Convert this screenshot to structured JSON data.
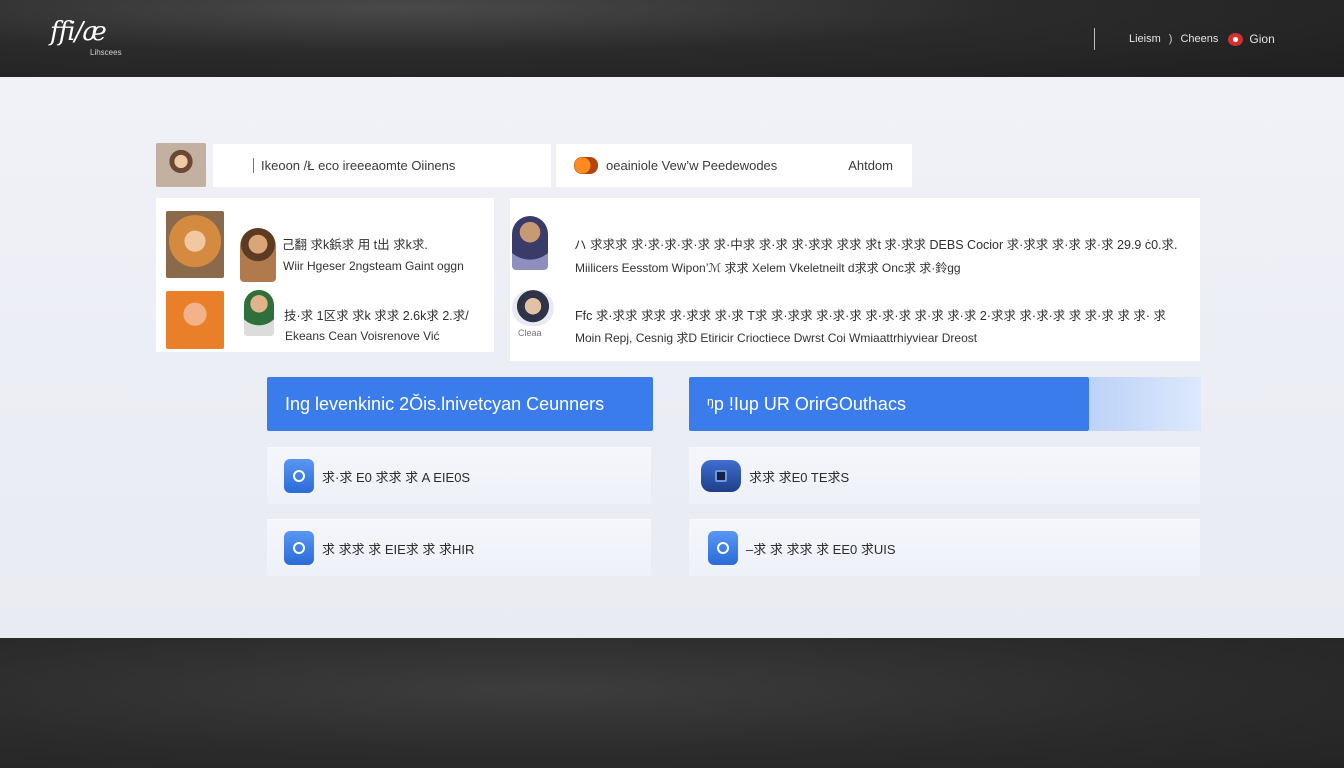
{
  "header": {
    "logo_mark": "ffi/æ",
    "logo_sub": "Lihscees",
    "nav": {
      "item1": "Lieism",
      "sep": ")",
      "item2": "Cheens",
      "lang": "Gion"
    }
  },
  "search": {
    "query": "Ikeoon /Ł eco ireeeaomte Oiinens",
    "secondary": "oeainiole Vew’w Peedewodes",
    "secondary_right": "Ahtdom"
  },
  "cards": {
    "left": {
      "line1": "己翻 求k鋲求 用 t出 求k求.",
      "line2": "Wiir Hgeser 2ngsteam Gaint oggn",
      "line3": "技·求 1区求 求k 求求 2.6k求 2.求/",
      "line4": "Ekeans Cean Voisrenove Vić"
    },
    "right": {
      "line1": "ハ 求求求 求·求·求·求·求 求·中求 求·求 求·求求 求求 求t 求·求求 DEBS Cocior  求·求求 求·求 求·求 29.9 ċ0.求.",
      "line2": "Miilicers  Eesstom  Wipon’ℳ 求求 Xelem Vkeletneilt  d求求 Onc求 求·鈴gg",
      "line3": "Ffc 求·求求 求求 求·求求 求·求 T求 求·求求 求·求·求 求·求·求 求·求 求·求 2·求求 求·求·求 求 求·求 求 求· 求",
      "line4": "Moin Repj, Cesnig 求D Etiricir Crioctiece Dwrst Coi Wmiaattrhiyviear Dreost",
      "caption": "Cleaa"
    }
  },
  "buttons": {
    "left_label": "Ing  levenkinic 2Ŏis.lnivetcyan Ceunners",
    "right_label": "ᵑp !Iup UR OrirGOuthacs"
  },
  "rows": {
    "left1": "求·求 E0 求求 求 A EIE0S",
    "left2": "求 求求 求 EIE求 求 求HIR",
    "right1": "求求  求E0 TE求S",
    "right2": "–求 求 求求 求 EE0 求UIS"
  }
}
